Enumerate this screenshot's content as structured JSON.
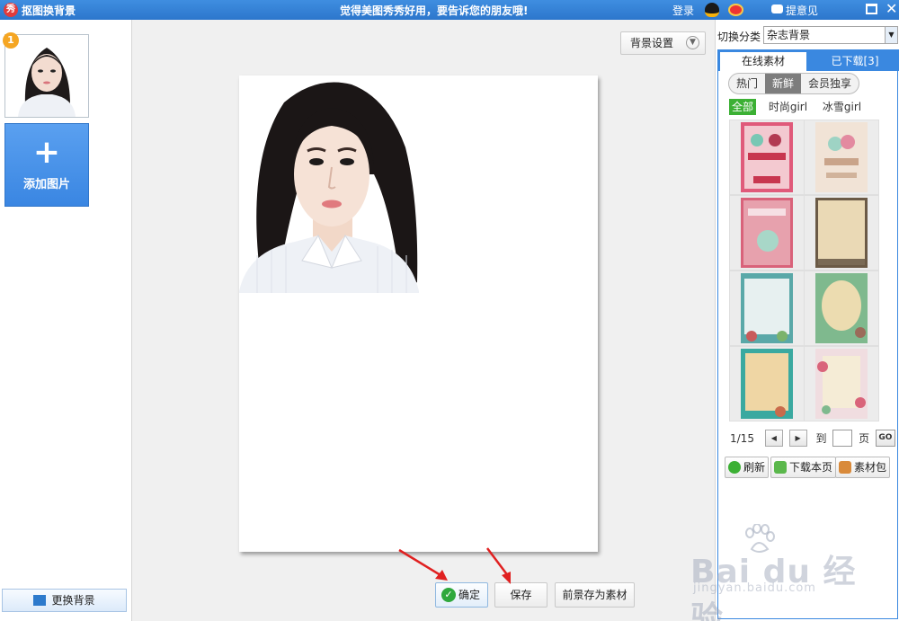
{
  "titlebar": {
    "app_icon_char": "秀",
    "title": "抠图换背景",
    "slogan": "觉得美图秀秀好用，要告诉您的朋友哦!",
    "login": "登录",
    "feedback": "提意见",
    "close_char": "✕"
  },
  "left_panel": {
    "thumb_badge": "1",
    "add_plus": "+",
    "add_label": "添加图片",
    "change_bg_label": "更换背景"
  },
  "center": {
    "bg_settings_label": "背景设置",
    "bg_settings_chevron": "▼",
    "confirm_label": "确定",
    "confirm_check": "✓",
    "save_label": "保存",
    "save_foreground_label": "前景存为素材"
  },
  "right_panel": {
    "category_label": "切换分类",
    "category_value": "杂志背景",
    "category_dropdown": "▼",
    "tabs": {
      "online": "在线素材",
      "downloaded": "已下载[3]"
    },
    "subtabs": [
      "热门",
      "新鲜",
      "会员独享"
    ],
    "active_subtab": 1,
    "filters": [
      "全部",
      "时尚girl",
      "冰雪girl"
    ],
    "active_filter": 0,
    "pager": {
      "page": "1/15",
      "prev": "◀",
      "next": "▶",
      "to": "到",
      "page_unit": "页",
      "go": "GO"
    },
    "actions": {
      "refresh": "刷新",
      "download_page": "下载本页",
      "material_pack": "素材包"
    }
  },
  "watermark": {
    "brand": "Bai du 经验",
    "url": "jingyan.baidu.com"
  },
  "colors": {
    "accent": "#3a88e0",
    "titlebar": "#2c76cc",
    "filter_active": "#3cb034",
    "confirm": "#2fa83d"
  }
}
